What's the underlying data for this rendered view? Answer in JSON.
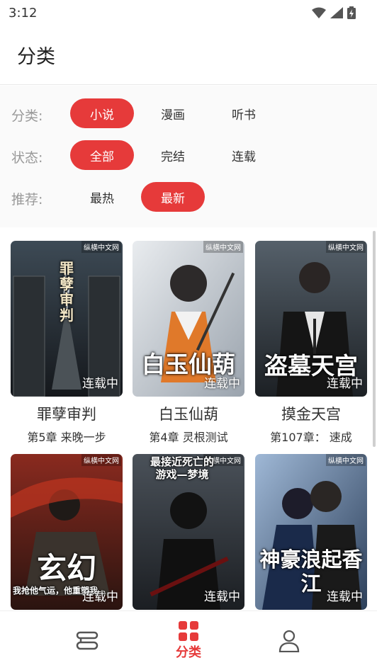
{
  "status_bar": {
    "time": "3:12"
  },
  "header": {
    "title": "分类"
  },
  "filters": {
    "category": {
      "label": "分类:",
      "options": [
        "小说",
        "漫画",
        "听书"
      ],
      "selected": "小说"
    },
    "status": {
      "label": "状态:",
      "options": [
        "全部",
        "完结",
        "连载"
      ],
      "selected": "全部"
    },
    "sort": {
      "label": "推荐:",
      "options": [
        "最热",
        "最新"
      ],
      "selected": "最新"
    }
  },
  "books": [
    {
      "title": "罪孽审判",
      "chapter": "第5章 来晚一步",
      "status": "连载中",
      "cover_text": "罪孽审判",
      "publisher": "纵横中文网"
    },
    {
      "title": "白玉仙葫",
      "chapter": "第4章 灵根测试",
      "status": "连载中",
      "cover_text": "白玉仙葫",
      "publisher": "纵横中文网"
    },
    {
      "title": "摸金天宫",
      "chapter": "第107章： 速成",
      "status": "连载中",
      "cover_text": "盗墓天宫",
      "publisher": "纵横中文网"
    },
    {
      "title": "",
      "chapter": "",
      "status": "连载中",
      "cover_text": "玄幻",
      "cover_subtext": "我抢他气运，他重塑我",
      "publisher": "纵横中文网"
    },
    {
      "title": "",
      "chapter": "",
      "status": "连载中",
      "cover_text": "最接近死亡的游戏—梦境",
      "publisher": "纵横中文网"
    },
    {
      "title": "",
      "chapter": "",
      "status": "连载中",
      "cover_text": "神豪浪起香江",
      "publisher": "纵横中文网"
    }
  ],
  "bottom_nav": {
    "items": [
      "",
      "分类",
      ""
    ],
    "active": "分类"
  },
  "colors": {
    "accent": "#e63a3a",
    "label": "#999999"
  },
  "icons": {
    "nav_home": "bookshelf-icon",
    "nav_category": "grid-icon",
    "nav_profile": "user-icon"
  }
}
